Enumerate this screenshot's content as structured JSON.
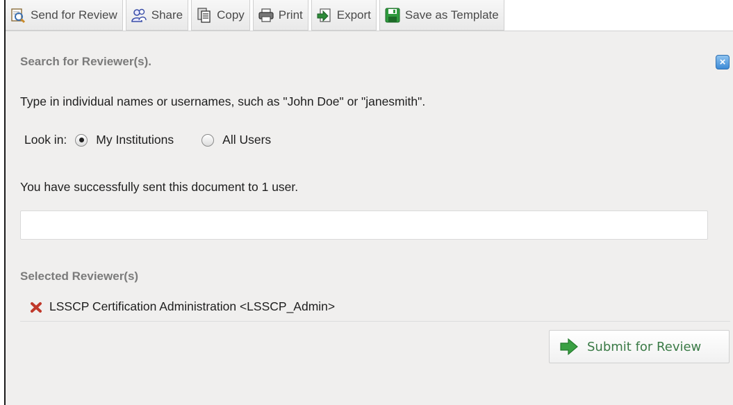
{
  "toolbar": {
    "buttons": [
      {
        "label": "Send for Review",
        "icon": "send-review-icon"
      },
      {
        "label": "Share",
        "icon": "share-icon"
      },
      {
        "label": "Copy",
        "icon": "copy-icon"
      },
      {
        "label": "Print",
        "icon": "print-icon"
      },
      {
        "label": "Export",
        "icon": "export-icon"
      },
      {
        "label": "Save as Template",
        "icon": "save-template-icon"
      }
    ]
  },
  "panel": {
    "title": "Search for Reviewer(s).",
    "close_label": "×",
    "hint": "Type in individual names or usernames, such as \"John Doe\" or \"janesmith\".",
    "look_in": {
      "label": "Look in:",
      "options": [
        "My Institutions",
        "All Users"
      ],
      "selected": "My Institutions"
    },
    "success_message": "You have successfully sent this document to 1 user.",
    "search": {
      "value": "",
      "placeholder": ""
    },
    "selected_title": "Selected Reviewer(s)",
    "reviewers": [
      "LSSCP Certification Administration <LSSCP_Admin>"
    ],
    "submit_label": "Submit for Review"
  },
  "colors": {
    "panel_bg": "#f0efee",
    "heading_gray": "#7b7b7b",
    "submit_green": "#3a7a46",
    "close_blue": "#3d8ad6",
    "remove_red": "#c0392b"
  }
}
